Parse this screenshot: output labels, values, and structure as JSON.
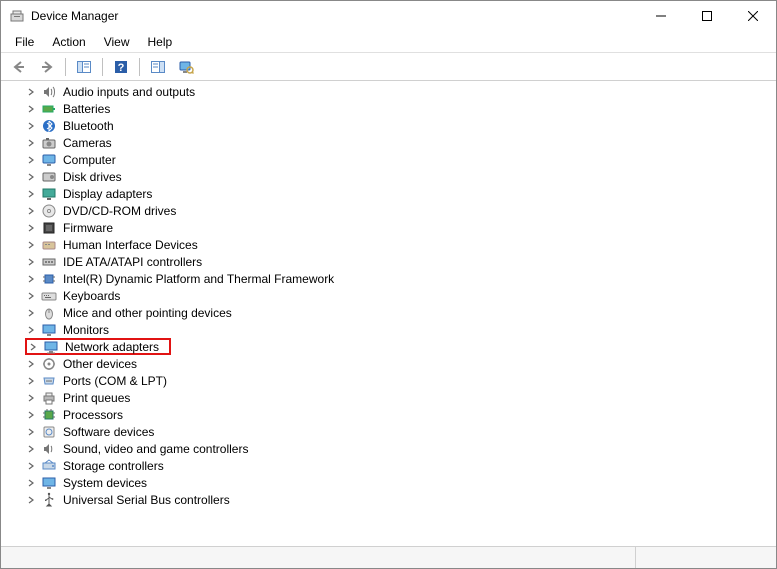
{
  "window": {
    "title": "Device Manager"
  },
  "menu": {
    "file": "File",
    "action": "Action",
    "view": "View",
    "help": "Help"
  },
  "toolbar": {
    "back": "back",
    "forward": "forward",
    "show_hide": "show-hide-console-tree",
    "help": "help",
    "action_icon": "action",
    "scan": "scan-hardware"
  },
  "tree": [
    {
      "key": "audio",
      "label": "Audio inputs and outputs",
      "icon": "speaker-icon"
    },
    {
      "key": "batteries",
      "label": "Batteries",
      "icon": "battery-icon"
    },
    {
      "key": "bluetooth",
      "label": "Bluetooth",
      "icon": "bluetooth-icon"
    },
    {
      "key": "cameras",
      "label": "Cameras",
      "icon": "camera-icon"
    },
    {
      "key": "computer",
      "label": "Computer",
      "icon": "computer-icon"
    },
    {
      "key": "disk",
      "label": "Disk drives",
      "icon": "disk-icon"
    },
    {
      "key": "display",
      "label": "Display adapters",
      "icon": "display-icon"
    },
    {
      "key": "dvd",
      "label": "DVD/CD-ROM drives",
      "icon": "dvd-icon"
    },
    {
      "key": "firmware",
      "label": "Firmware",
      "icon": "firmware-icon"
    },
    {
      "key": "hid",
      "label": "Human Interface Devices",
      "icon": "hid-icon"
    },
    {
      "key": "ide",
      "label": "IDE ATA/ATAPI controllers",
      "icon": "ide-icon"
    },
    {
      "key": "intel",
      "label": "Intel(R) Dynamic Platform and Thermal Framework",
      "icon": "chip-icon"
    },
    {
      "key": "keyboards",
      "label": "Keyboards",
      "icon": "keyboard-icon"
    },
    {
      "key": "mice",
      "label": "Mice and other pointing devices",
      "icon": "mouse-icon"
    },
    {
      "key": "monitors",
      "label": "Monitors",
      "icon": "monitor-icon"
    },
    {
      "key": "network",
      "label": "Network adapters",
      "icon": "network-icon",
      "highlighted": true
    },
    {
      "key": "other",
      "label": "Other devices",
      "icon": "other-icon"
    },
    {
      "key": "ports",
      "label": "Ports (COM & LPT)",
      "icon": "port-icon"
    },
    {
      "key": "print",
      "label": "Print queues",
      "icon": "printer-icon"
    },
    {
      "key": "processors",
      "label": "Processors",
      "icon": "cpu-icon"
    },
    {
      "key": "software",
      "label": "Software devices",
      "icon": "software-icon"
    },
    {
      "key": "sound",
      "label": "Sound, video and game controllers",
      "icon": "sound-icon"
    },
    {
      "key": "storage",
      "label": "Storage controllers",
      "icon": "storage-icon"
    },
    {
      "key": "system",
      "label": "System devices",
      "icon": "system-icon"
    },
    {
      "key": "usb",
      "label": "Universal Serial Bus controllers",
      "icon": "usb-icon"
    }
  ]
}
